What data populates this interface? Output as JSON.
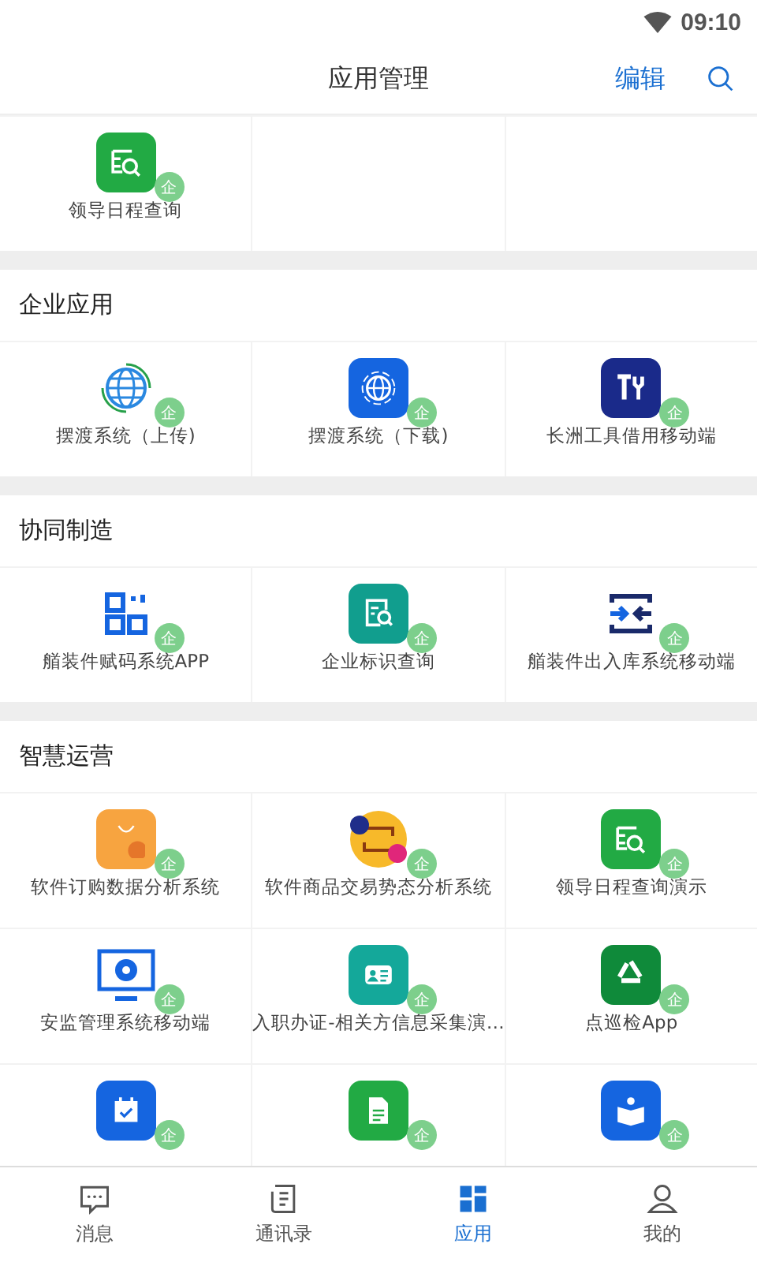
{
  "status_bar": {
    "time": "09:10"
  },
  "header": {
    "title": "应用管理",
    "edit": "编辑"
  },
  "sections": [
    {
      "apps": [
        {
          "label": "领导日程查询",
          "badge": "企"
        }
      ]
    },
    {
      "title": "企业应用",
      "apps": [
        {
          "label": "摆渡系统（上传)",
          "badge": "企"
        },
        {
          "label": "摆渡系统（下载)",
          "badge": "企"
        },
        {
          "label": "长洲工具借用移动端",
          "badge": "企"
        }
      ]
    },
    {
      "title": "协同制造",
      "apps": [
        {
          "label": "艏装件赋码系统APP",
          "badge": "企"
        },
        {
          "label": "企业标识查询",
          "badge": "企"
        },
        {
          "label": "艏装件出入库系统移动端",
          "badge": "企"
        }
      ]
    },
    {
      "title": "智慧运营",
      "apps": [
        {
          "label": "软件订购数据分析系统",
          "badge": "企"
        },
        {
          "label": "软件商品交易势态分析系统",
          "badge": "企"
        },
        {
          "label": "领导日程查询演示",
          "badge": "企"
        },
        {
          "label": "安监管理系统移动端",
          "badge": "企"
        },
        {
          "label": "入职办证-相关方信息采集演…",
          "badge": "企"
        },
        {
          "label": "点巡检App",
          "badge": "企"
        },
        {
          "badge": "企"
        },
        {
          "badge": "企"
        },
        {
          "badge": "企"
        }
      ]
    }
  ],
  "nav": [
    {
      "label": "消息",
      "selected": false
    },
    {
      "label": "通讯录",
      "selected": false
    },
    {
      "label": "应用",
      "selected": true
    },
    {
      "label": "我的",
      "selected": false
    }
  ]
}
